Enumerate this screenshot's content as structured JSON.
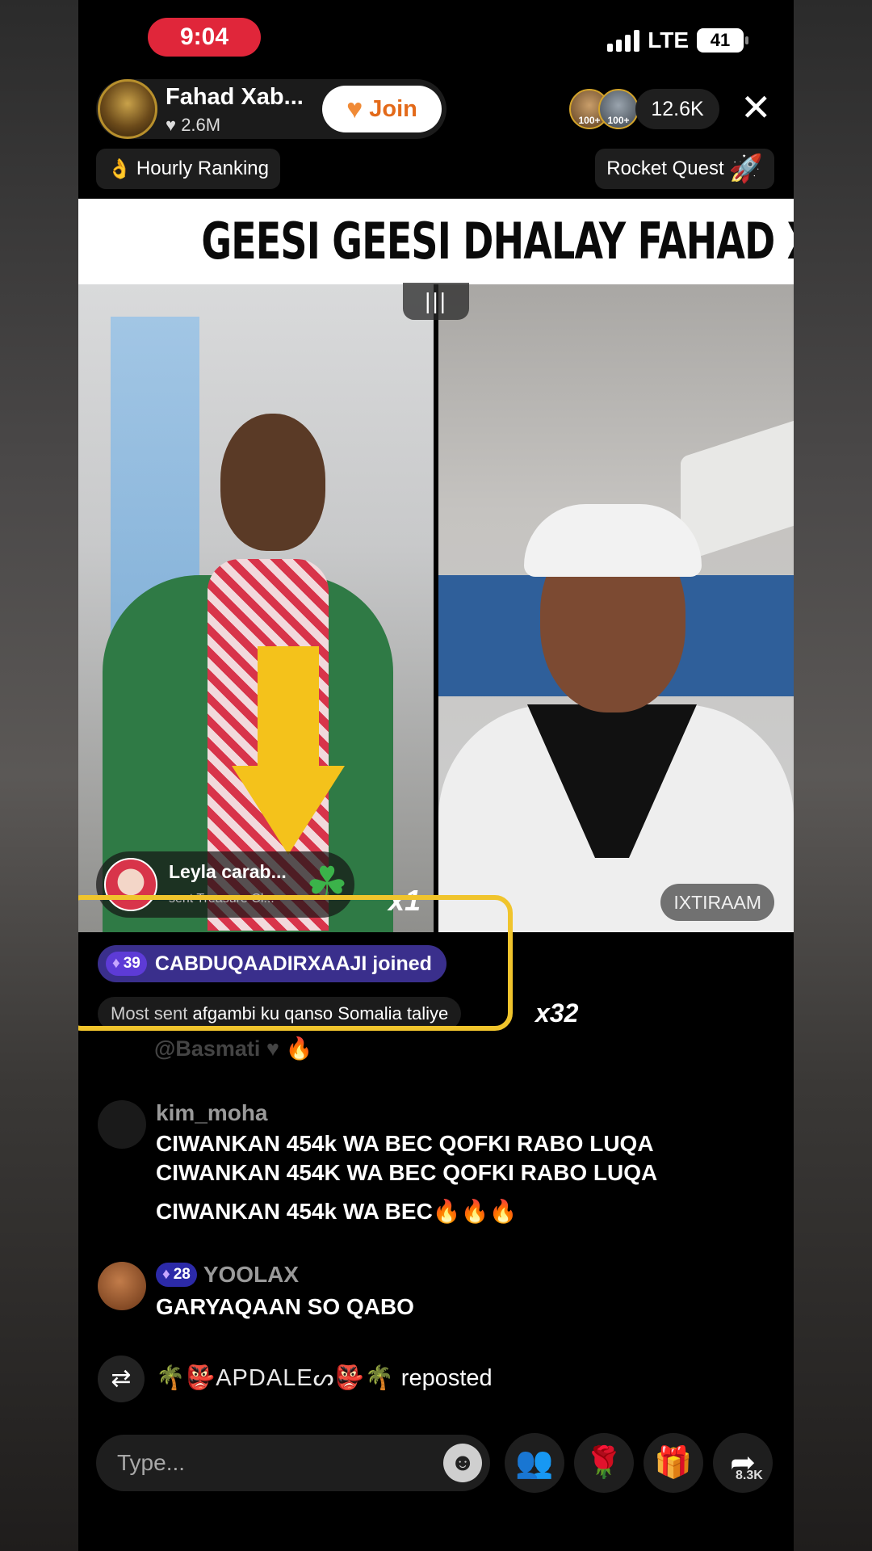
{
  "status_bar": {
    "time": "9:04",
    "network": "LTE",
    "battery": "41"
  },
  "host": {
    "name": "Fahad Xab...",
    "likes": "2.6M",
    "join_label": "Join"
  },
  "viewers": {
    "badge_a": "100+",
    "badge_b": "100+",
    "count": "12.6K"
  },
  "chips": {
    "hourly_ranking": "Hourly Ranking",
    "rocket_quest": "Rocket Quest"
  },
  "title_banner": "GEESI GEESI DHALAY FAHAD XABAD",
  "guest_name_tag": "IXTIRAAM",
  "gift": {
    "sender": "Leyla carab...",
    "description": "sent Treasure Cl...",
    "count": "x1"
  },
  "join_notice": {
    "level": "39",
    "text": "CABDUQAADIRXAAJI joined"
  },
  "most_sent": {
    "prefix": "Most sent",
    "text": "afgambi ku qanso Somalia taliye",
    "count": "x32"
  },
  "faded_comment": "@Basmati",
  "comments": [
    {
      "user": "kim_moha",
      "lines": [
        "CIWANKAN 454k WA BEC QOFKI RABO LUQA",
        "CIWANKAN 454K WA BEC QOFKI RABO LUQA",
        "CIWANKAN 454k WA BEC🔥🔥🔥"
      ]
    },
    {
      "user": "YOOLAX",
      "level": "28",
      "lines": [
        "GARYAQAAN SO QABO"
      ]
    }
  ],
  "repost": {
    "nickname": "🌴👺ΑΡDΑLΕᔕ👺🌴",
    "action": "reposted"
  },
  "bottom_bar": {
    "input_placeholder": "Type...",
    "share_count": "8.3K"
  },
  "colors": {
    "time_pill": "#e0263a",
    "join_text": "#e36a1a",
    "highlight_box": "#f0c42c",
    "join_badge_bg": "#3a2f8c",
    "gift_button": "#ff3b5c",
    "arrow": "#f4c21b"
  },
  "icons": {
    "close": "close-icon",
    "heart": "heart-icon",
    "fire": "fire-icon",
    "rocket": "rocket-icon",
    "clover": "clover-icon",
    "gem": "gem-icon",
    "repost": "repost-icon",
    "emoji": "emoji-icon",
    "multi_guest": "multi-guest-icon",
    "rose": "rose-icon",
    "gift": "gift-icon",
    "share": "share-icon"
  }
}
